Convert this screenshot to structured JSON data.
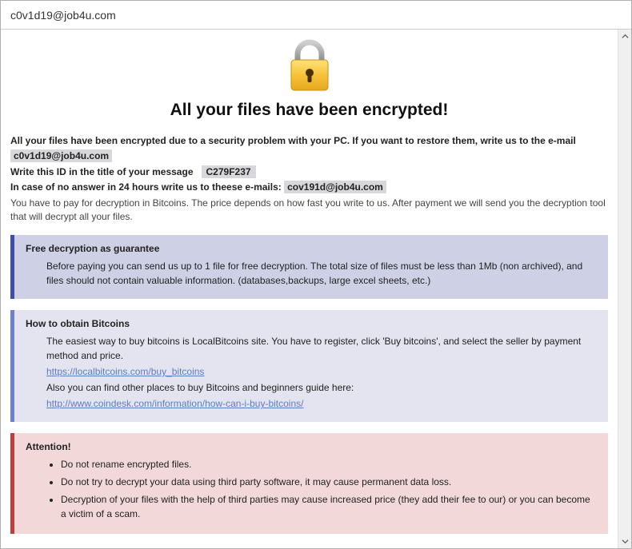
{
  "titlebar": {
    "text": "c0v1d19@job4u.com"
  },
  "heading": "All your files have been encrypted!",
  "intro": {
    "line1": "All your files have been encrypted due to a security problem with your PC. If you want to restore them, write us to the e-mail",
    "email1": "c0v1d19@job4u.com",
    "line2_pre": "Write this ID in the title of your message",
    "id": "C279F237",
    "line3_pre": "In case of no answer in 24 hours write us to theese e-mails:",
    "email2": "cov191d@job4u.com",
    "line4": "You have to pay for decryption in Bitcoins. The price depends on how fast you write to us. After payment we will send you the decryption tool that will decrypt all your files."
  },
  "panels": {
    "guarantee": {
      "title": "Free decryption as guarantee",
      "body": "Before paying you can send us up to 1 file for free decryption. The total size of files must be less than 1Mb (non archived), and files should not contain valuable information. (databases,backups, large excel sheets, etc.)"
    },
    "obtain": {
      "title": "How to obtain Bitcoins",
      "body1": "The easiest way to buy bitcoins is LocalBitcoins site. You have to register, click 'Buy bitcoins', and select the seller by payment method and price.",
      "link1": "https://localbitcoins.com/buy_bitcoins",
      "body2": "Also you can find other places to buy Bitcoins and beginners guide here:",
      "link2": "http://www.coindesk.com/information/how-can-i-buy-bitcoins/"
    },
    "attention": {
      "title": "Attention!",
      "items": [
        "Do not rename encrypted files.",
        "Do not try to decrypt your data using third party software, it may cause permanent data loss.",
        "Decryption of your files with the help of third parties may cause increased price (they add their fee to our) or you can become a victim of a scam."
      ]
    }
  }
}
